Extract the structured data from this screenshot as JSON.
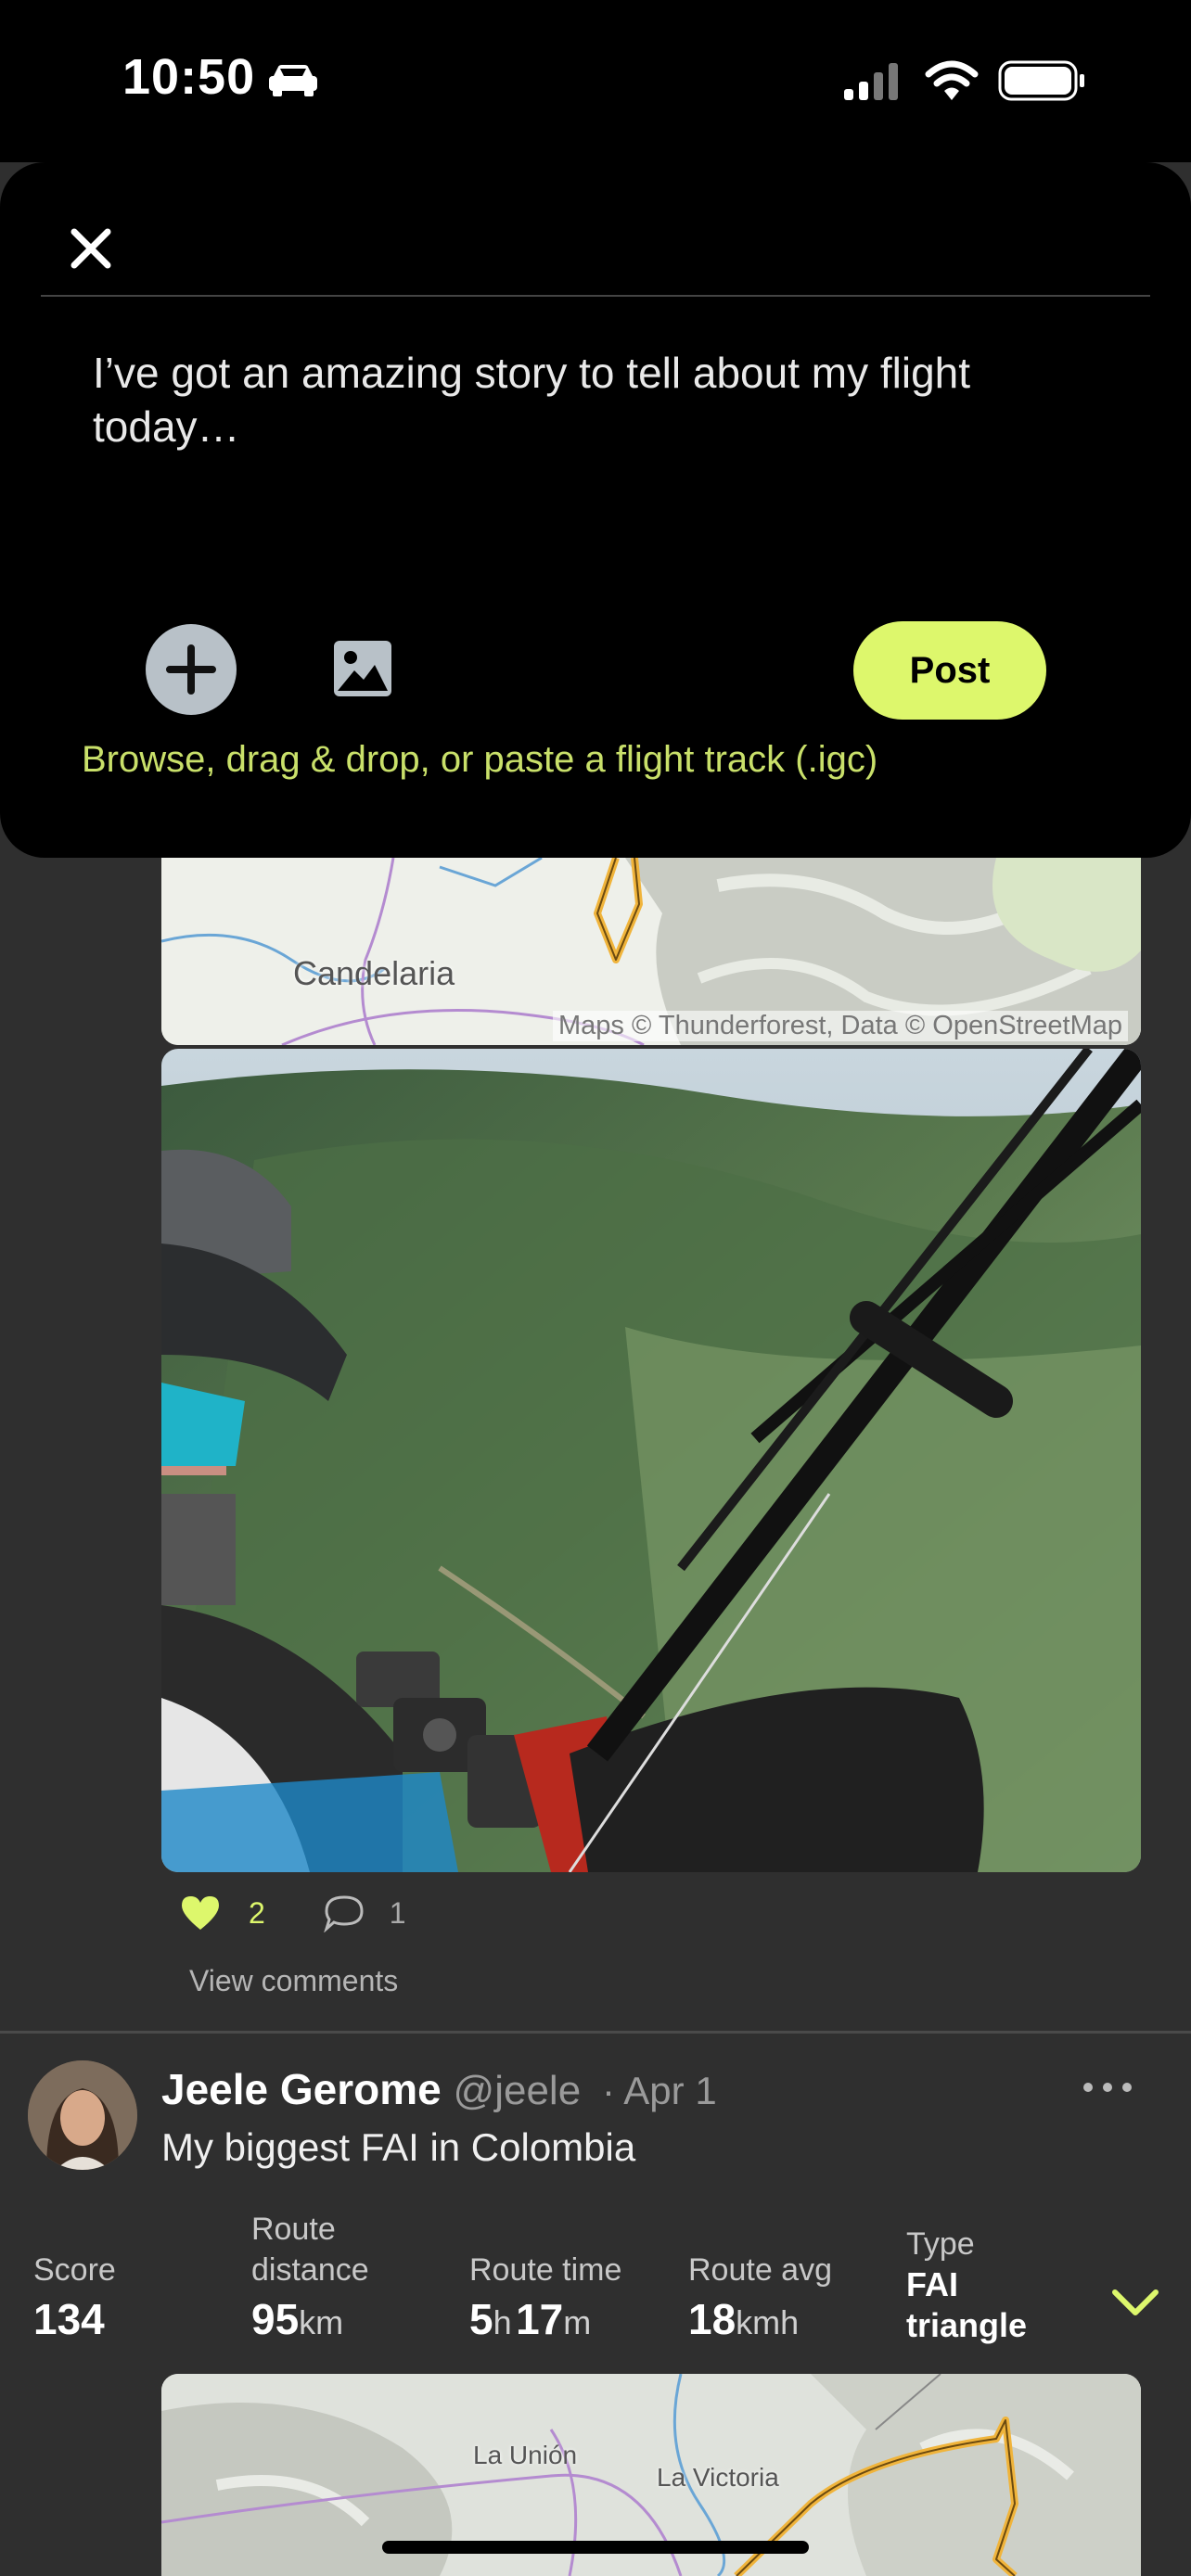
{
  "status_bar": {
    "time": "10:50"
  },
  "composer": {
    "text": "I’ve got an amazing story to tell about my flight today…",
    "post_label": "Post",
    "hint": "Browse, drag & drop, or paste a flight track (.igc)"
  },
  "post1": {
    "map": {
      "place_label": "Candelaria",
      "attribution": "Maps © Thunderforest, Data © OpenStreetMap"
    },
    "likes": "2",
    "comments": "1",
    "view_comments": "View comments"
  },
  "post2": {
    "author": "Jeele Gerome",
    "handle": "@jeele",
    "date": "· Apr 1",
    "title": "My biggest FAI in Colombia",
    "stats": {
      "score_label": "Score",
      "score_value": "134",
      "distance_label_1": "Route",
      "distance_label_2": "distance",
      "distance_value": "95",
      "distance_unit": "km",
      "time_label": "Route time",
      "time_hours": "5",
      "time_h_unit": "h",
      "time_minutes": "17",
      "time_m_unit": "m",
      "avg_label": "Route avg",
      "avg_value": "18",
      "avg_unit": "kmh",
      "type_label": "Type",
      "type_value_1": "FAI",
      "type_value_2": "triangle"
    },
    "map": {
      "label_1": "La Unión",
      "label_2": "La Victoria"
    }
  },
  "colors": {
    "accent": "#ddf76c",
    "background": "#2f2f2f",
    "sheet": "#000000"
  },
  "icons": [
    "car-icon",
    "signal-icon",
    "wifi-icon",
    "battery-icon",
    "close-icon",
    "plus-icon",
    "image-icon",
    "heart-icon",
    "comment-icon",
    "more-icon",
    "chevron-down-icon"
  ]
}
